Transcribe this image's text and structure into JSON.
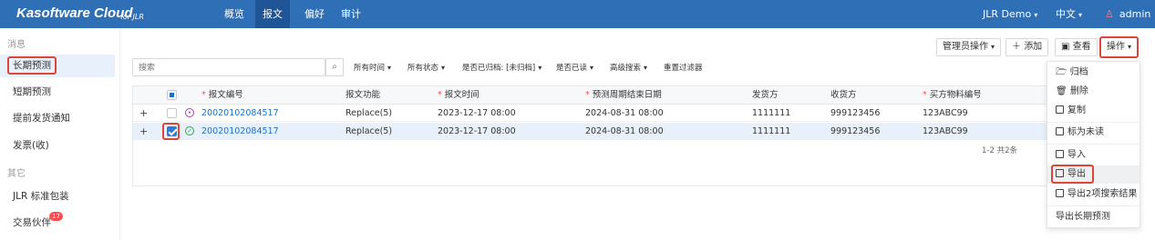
{
  "app": {
    "brand": "Kasoftware Cloud",
    "brand_sub": "for JLR"
  },
  "nav": {
    "items": [
      {
        "label": "概览"
      },
      {
        "label": "报文"
      },
      {
        "label": "偏好"
      },
      {
        "label": "审计"
      }
    ],
    "active": "报文",
    "org": "JLR Demo",
    "language": "中文",
    "user": "admin"
  },
  "sidebar": {
    "section1": "消息",
    "items": [
      {
        "label": "长期预测"
      },
      {
        "label": "短期预测"
      },
      {
        "label": "提前发货通知"
      },
      {
        "label": "发票(收)"
      }
    ],
    "section2": "其它",
    "other": [
      {
        "label": "JLR 标准包装"
      },
      {
        "label": "交易伙伴",
        "badge": "17"
      }
    ]
  },
  "toolbar": {
    "admin_ops": "管理员操作",
    "add": "添加",
    "view": "查看",
    "actions": "操作"
  },
  "filters": {
    "search_placeholder": "搜索",
    "time": "所有时间",
    "status": "所有状态",
    "archived": "是否已归档: [未归档]",
    "read": "是否已读",
    "advanced": "高级搜索",
    "reset": "重置过滤器"
  },
  "table": {
    "columns": [
      "报文编号",
      "报文功能",
      "报文时间",
      "预测周期结束日期",
      "发货方",
      "收货方",
      "买方物料编号"
    ],
    "rows": [
      {
        "id": "20020102084517",
        "func": "Replace(5)",
        "time": "2023-12-17 08:00",
        "end": "2024-08-31 08:00",
        "sender": "1111111",
        "receiver": "999123456",
        "part": "123ABC99"
      },
      {
        "id": "20020102084517",
        "func": "Replace(5)",
        "time": "2023-12-17 08:00",
        "end": "2024-08-31 08:00",
        "sender": "1111111",
        "receiver": "999123456",
        "part": "123ABC99"
      }
    ],
    "pager": "1-2 共2条"
  },
  "menu": {
    "items": [
      {
        "label": "归档"
      },
      {
        "label": "删除"
      },
      {
        "label": "复制"
      },
      {
        "label": "标为未读"
      },
      {
        "label": "导入"
      },
      {
        "label": "导出"
      },
      {
        "label": "导出2项搜索结果"
      },
      {
        "label": "导出长期预测"
      }
    ]
  },
  "colors": {
    "topbar": "#2f6fb5",
    "nav_active": "#1f5597",
    "highlight": "#d9473b",
    "link": "#1f6fc5"
  }
}
